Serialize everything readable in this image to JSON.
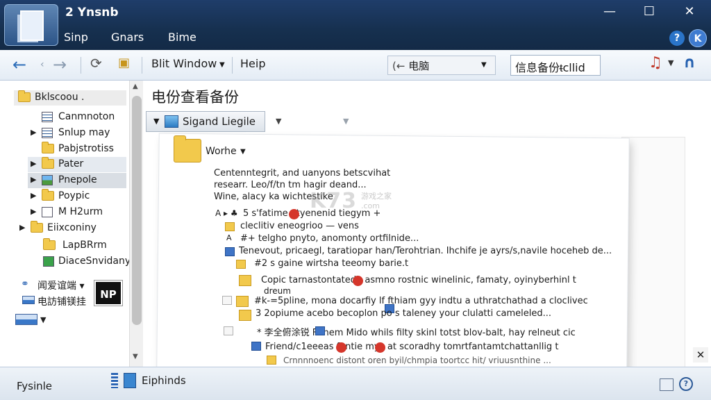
{
  "window": {
    "title": "2 Ynsnb",
    "close_glyph": "✕",
    "maximize_glyph": "☐",
    "minimize_glyph": "—"
  },
  "menu": [
    "Sinp",
    "Gnars",
    "Bime"
  ],
  "toolbar": {
    "back_glyph": "←",
    "forward_glyph": "→",
    "window_label": "Blit Window",
    "help_label": "Heip",
    "address_value": "电脑",
    "address_left_glyph": "(←",
    "search_value": "信息备份ᵵcllid"
  },
  "sidebar": {
    "items": [
      {
        "label": "Bklscoou .",
        "icon": "folder-icon"
      },
      {
        "label": "Canmnoton",
        "icon": "list-icon"
      },
      {
        "label": "Snlup may",
        "icon": "list-icon"
      },
      {
        "label": "Pabjstrotiss",
        "icon": "folder-icon"
      },
      {
        "label": "Pater",
        "icon": "folder-icon"
      },
      {
        "label": "Pnepole",
        "icon": "picture-icon"
      },
      {
        "label": "Poypic",
        "icon": "folder-icon"
      },
      {
        "label": "M H2urm",
        "icon": "document-icon"
      },
      {
        "label": "Eiixconiny",
        "icon": "folder-icon"
      },
      {
        "label": "LapBRrm",
        "icon": "folder-icon"
      },
      {
        "label": "DiaceSnvidany",
        "icon": "document-icon"
      },
      {
        "label": "闻爱谊端 ▾",
        "icon": "network-icon"
      },
      {
        "label": "电訪铺镁挂",
        "icon": "computer-icon"
      }
    ],
    "badge": "NP"
  },
  "main": {
    "heading": "电份查看备份",
    "dropdown_label": "Sigand Liegile",
    "folder_label": "Worhe",
    "paragraph": [
      "Centenntegrit, and uanyons betscvihat",
      "researr. Leo/f/tn tm hagir deand...",
      "Wine, alacy ka wichtestike"
    ],
    "entries": [
      "5 s'fatime     atyenenid tiegym +",
      "cleclitiv eneogrioo — vens",
      "#+ telgho pnyto, anomonty ortfilnide...",
      "Tenevout, pricaegl, taratiopar han/Terohtrian. Ihchife je ayrs/s,navile hoceheb de...",
      "#2 s gaine wirtsha teeomy barie.t",
      "Copic tarnastontatedb     asmno rostnic winelinic, famaty, oyinyberhinl t",
      "dreum",
      "#k-=5pline, mona docarfiy   lf fthiam gyy indtu a uthratchathad a cloclivec",
      "3 2opiume acebo becoplon po      s taleney your clulatti cameleled...",
      "*   李全俯涂锐   Fdhem Mido   whils filty skinl totst blov-balt, hay relneut cic",
      "Friend/c1eeeas     fontie     myc at scoradhy tomrtfantamtchattanllig t",
      "Crnnnnoenc distont oren byil/chmpia toortcc hit/ vriuusnthine ..."
    ]
  },
  "watermark": {
    "main": "K73",
    "sub": "游戏之家",
    "sub2": ".com"
  },
  "status": {
    "left": "Fysinle",
    "middle": "Eiphinds"
  },
  "colors": {
    "titlebar": "#16304f",
    "accent": "#2b6cb8",
    "folder": "#f2c94c",
    "red_marker": "#d5362b"
  }
}
